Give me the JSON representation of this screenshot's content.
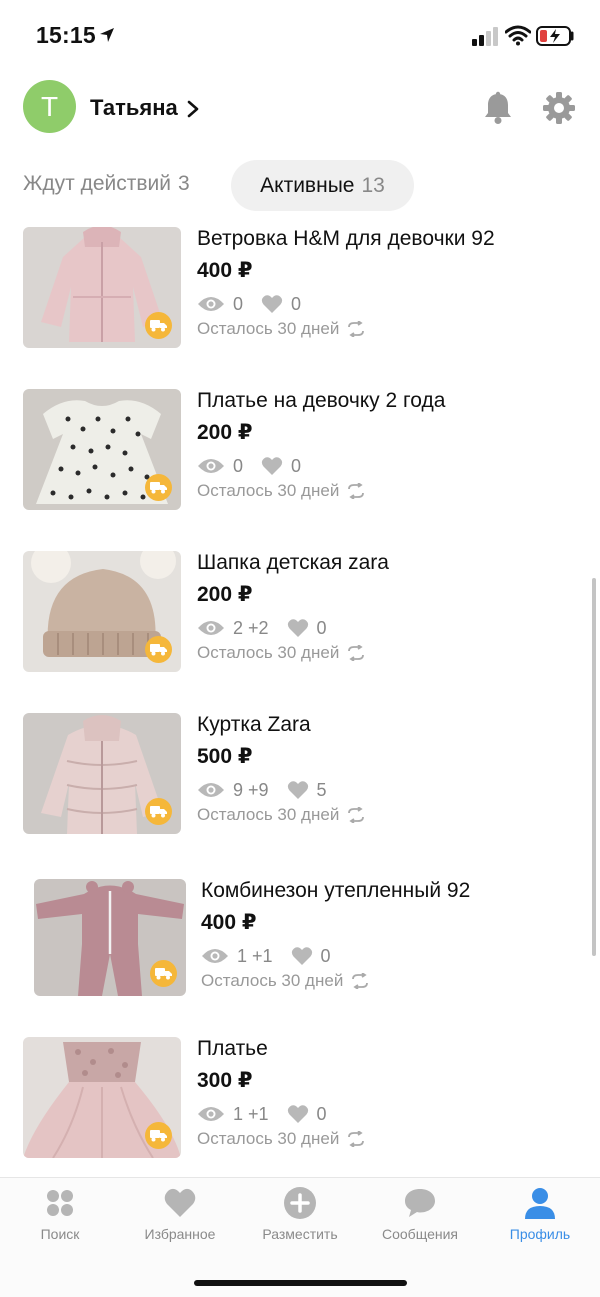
{
  "status_bar": {
    "time": "15:15"
  },
  "header": {
    "avatar_letter": "Т",
    "user_name": "Татьяна"
  },
  "tabs": [
    {
      "label": "Ждут действий",
      "count": "3"
    },
    {
      "label": "Активные",
      "count": "13"
    }
  ],
  "listings": [
    {
      "title": "Ветровка H&M для девочки 92",
      "price": "400 ₽",
      "views": "0",
      "likes": "0",
      "remaining": "Осталось 30 дней",
      "image": "pink-windbreaker"
    },
    {
      "title": "Платье на девочку 2 года",
      "price": "200 ₽",
      "views": "0",
      "likes": "0",
      "remaining": "Осталось 30 дней",
      "image": "polka-dot-dress"
    },
    {
      "title": "Шапка детская zara",
      "price": "200 ₽",
      "views": "2 +2",
      "likes": "0",
      "remaining": "Осталось 30 дней",
      "image": "knit-hat"
    },
    {
      "title": "Куртка Zara",
      "price": "500 ₽",
      "views": "9 +9",
      "likes": "5",
      "remaining": "Осталось 30 дней",
      "image": "puffer-jacket"
    },
    {
      "title": "Комбинезон утепленный 92",
      "price": "400 ₽",
      "views": "1 +1",
      "likes": "0",
      "remaining": "Осталось 30 дней",
      "image": "pink-jumpsuit"
    },
    {
      "title": "Платье",
      "price": "300 ₽",
      "views": "1 +1",
      "likes": "0",
      "remaining": "Осталось 30 дней",
      "image": "tulle-dress"
    }
  ],
  "tabbar": [
    {
      "label": "Поиск",
      "icon": "search-dots-icon"
    },
    {
      "label": "Избранное",
      "icon": "heart-icon"
    },
    {
      "label": "Разместить",
      "icon": "plus-circle-icon"
    },
    {
      "label": "Сообщения",
      "icon": "chat-bubble-icon"
    },
    {
      "label": "Профиль",
      "icon": "person-icon",
      "active": true
    }
  ],
  "colors": {
    "accent": "#3a8ee6",
    "avatar": "#8fcc6a",
    "delivery_badge": "#f5b73a",
    "muted_text": "#888888"
  }
}
